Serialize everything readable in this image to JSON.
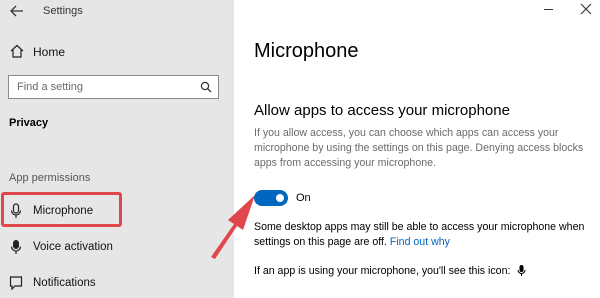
{
  "header": {
    "app_title": "Settings"
  },
  "sidebar": {
    "home_label": "Home",
    "search_placeholder": "Find a setting",
    "section_title": "Privacy",
    "group_label": "App permissions",
    "items": [
      {
        "label": "Microphone",
        "icon": "microphone-icon",
        "selected": true
      },
      {
        "label": "Voice activation",
        "icon": "voice-activation-icon",
        "selected": false
      },
      {
        "label": "Notifications",
        "icon": "notifications-icon",
        "selected": false
      }
    ]
  },
  "main": {
    "title": "Microphone",
    "heading": "Allow apps to access your microphone",
    "description": "If you allow access, you can choose which apps can access your microphone by using the settings on this page. Denying access blocks apps from accessing your microphone.",
    "toggle_state": "On",
    "note_text": "Some desktop apps may still be able to access your microphone when settings on this page are off.",
    "note_link": "Find out why",
    "note2": "If an app is using your microphone, you'll see this icon:"
  },
  "colors": {
    "accent": "#0067c0",
    "highlight": "#e0474c",
    "sidebar_bg": "#e6e6e6"
  }
}
